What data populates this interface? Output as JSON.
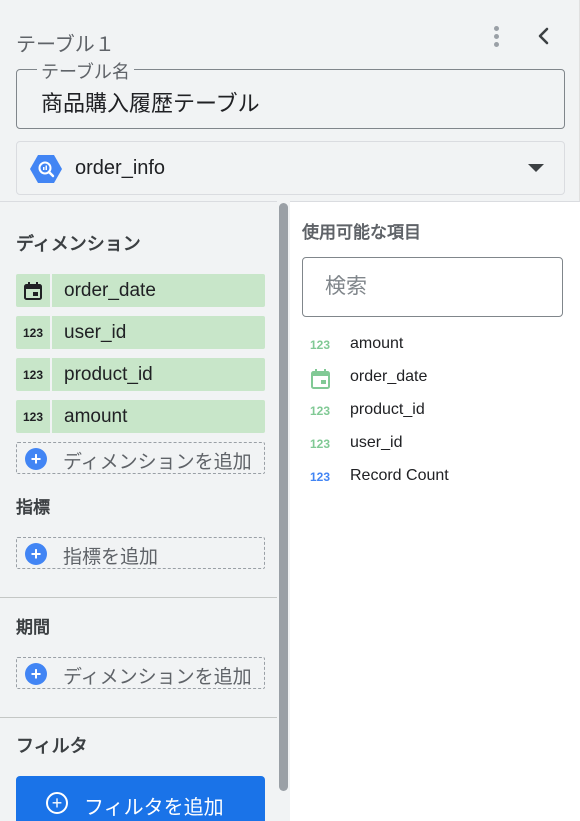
{
  "header": {
    "title": "テーブル１"
  },
  "table_name": {
    "legend": "テーブル名",
    "value": "商品購入履歴テーブル"
  },
  "data_source": {
    "label": "order_info",
    "icon": "bigquery-icon"
  },
  "dimensions": {
    "title": "ディメンション",
    "items": [
      {
        "label": "order_date",
        "icon": "calendar-icon"
      },
      {
        "label": "user_id",
        "icon": "numeric-icon"
      },
      {
        "label": "product_id",
        "icon": "numeric-icon"
      },
      {
        "label": "amount",
        "icon": "numeric-icon"
      }
    ],
    "add_label": "ディメンションを追加"
  },
  "metrics": {
    "title": "指標",
    "add_label": "指標を追加"
  },
  "period": {
    "title": "期間",
    "add_label": "ディメンションを追加"
  },
  "filter": {
    "title": "フィルタ",
    "button_label": "フィルタを追加"
  },
  "available_fields": {
    "title": "使用可能な項目",
    "search_placeholder": "検索",
    "items": [
      {
        "label": "amount",
        "icon": "numeric-icon",
        "icon_text": "123"
      },
      {
        "label": "order_date",
        "icon": "calendar-icon",
        "icon_text": ""
      },
      {
        "label": "product_id",
        "icon": "numeric-icon",
        "icon_text": "123"
      },
      {
        "label": "user_id",
        "icon": "numeric-icon",
        "icon_text": "123"
      },
      {
        "label": "Record Count",
        "icon": "numeric-icon",
        "icon_text": "123"
      }
    ]
  },
  "icon_glyphs": {
    "numeric": "123"
  },
  "colors": {
    "chip_bg": "#c8e6c9",
    "accent_blue": "#1a73e8",
    "metric_green": "#81c995",
    "metric_blue": "#4285f4"
  }
}
